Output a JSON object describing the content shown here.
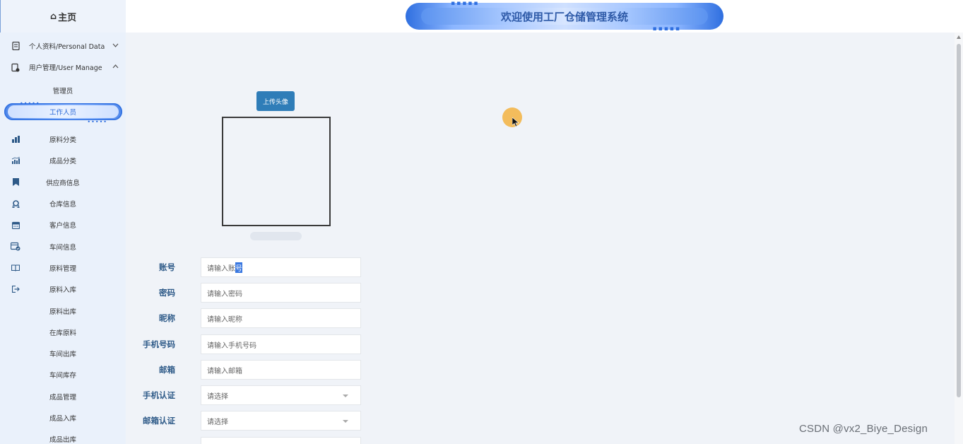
{
  "sidebar": {
    "home_label": "主页",
    "personal": {
      "label": "个人资料/Personal Data"
    },
    "user_manage": {
      "label": "用户管理/User Manage"
    },
    "sub_items": [
      "管理员",
      "工作人员"
    ],
    "items": [
      {
        "label": "原料分类"
      },
      {
        "label": "成品分类"
      },
      {
        "label": "供应商信息"
      },
      {
        "label": "仓库信息"
      },
      {
        "label": "客户信息"
      },
      {
        "label": "车间信息"
      },
      {
        "label": "原料管理"
      },
      {
        "label": "原料入库"
      },
      {
        "label": "原料出库"
      },
      {
        "label": "在库原料"
      },
      {
        "label": "车间出库"
      },
      {
        "label": "车间库存"
      },
      {
        "label": "成品管理"
      },
      {
        "label": "成品入库"
      },
      {
        "label": "成品出库"
      }
    ]
  },
  "header": {
    "title": "欢迎使用工厂仓储管理系统"
  },
  "main": {
    "upload_label": "上传头像",
    "form": {
      "account": {
        "label": "账号",
        "placeholder_a": "请输入账",
        "placeholder_b": "号"
      },
      "password": {
        "label": "密码",
        "placeholder": "请输入密码"
      },
      "nickname": {
        "label": "昵称",
        "placeholder": "请输入昵称"
      },
      "phone": {
        "label": "手机号码",
        "placeholder": "请输入手机号码"
      },
      "email": {
        "label": "邮箱",
        "placeholder": "请输入邮箱"
      },
      "phone_verify": {
        "label": "手机认证",
        "placeholder": "请选择"
      },
      "email_verify": {
        "label": "邮箱认证",
        "placeholder": "请选择"
      }
    }
  },
  "watermark": "CSDN @vx2_Biye_Design",
  "colors": {
    "accent": "#2f7db8",
    "label": "#2e5a88",
    "sidebar_bg": "#eaf1fb"
  }
}
